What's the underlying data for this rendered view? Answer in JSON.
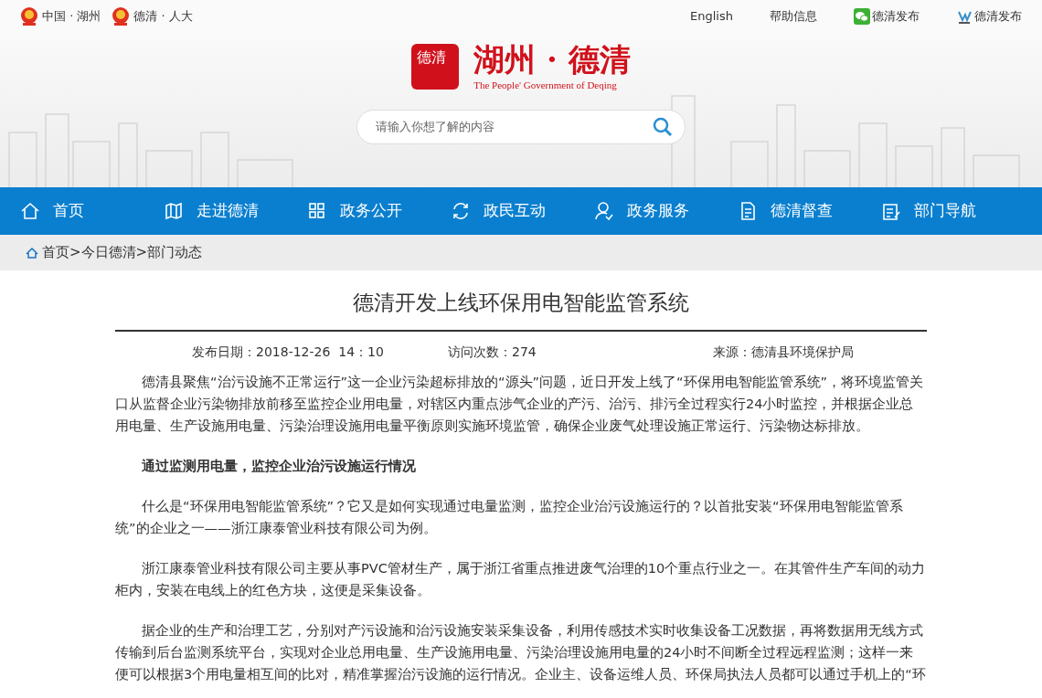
{
  "top_links_left": [
    {
      "label": "中国 · 湖州"
    },
    {
      "label": "德清 · 人大"
    }
  ],
  "top_links_right": [
    {
      "kind": "text",
      "label": "English"
    },
    {
      "kind": "text",
      "label": "帮助信息"
    },
    {
      "kind": "wechat",
      "label": "德清发布"
    },
    {
      "kind": "weibo",
      "label": "德清发布"
    }
  ],
  "logo": {
    "seal": "德清",
    "title": "湖州 · 德清",
    "subtitle": "The People' Government of Deqing"
  },
  "search": {
    "placeholder": "请输入你想了解的内容"
  },
  "nav": [
    {
      "label": "首页"
    },
    {
      "label": "走进德清"
    },
    {
      "label": "政务公开"
    },
    {
      "label": "政民互动"
    },
    {
      "label": "政务服务"
    },
    {
      "label": "德清督查"
    },
    {
      "label": "部门导航"
    }
  ],
  "breadcrumb": [
    "首页",
    ">",
    "今日德清",
    ">",
    "部门动态"
  ],
  "article": {
    "title": "德清开发上线环保用电智能监管系统",
    "meta": [
      "发布日期：2018-12-26  14：10",
      "访问次数：274",
      "来源：德清县环境保护局"
    ],
    "paragraphs": [
      {
        "kind": "text",
        "text": "德清县聚焦“治污设施不正常运行”这一企业污染超标排放的“源头”问题，近日开发上线了“环保用电智能监管系统”，将环境监管关口从监督企业污染物排放前移至监控企业用电量，对辖区内重点涉气企业的产污、治污、排污全过程实行24小时监控，并根据企业总用电量、生产设施用电量、污染治理设施用电量平衡原则实施环境监管，确保企业废气处理设施正常运行、污染物达标排放。"
      },
      {
        "kind": "heading",
        "text": "通过监测用电量，监控企业治污设施运行情况"
      },
      {
        "kind": "text",
        "text": "什么是“环保用电智能监管系统”？它又是如何实现通过电量监测，监控企业治污设施运行的？以首批安装“环保用电智能监管系统”的企业之一——浙江康泰管业科技有限公司为例。"
      },
      {
        "kind": "text",
        "text": "浙江康泰管业科技有限公司主要从事PVC管材生产，属于浙江省重点推进废气治理的10个重点行业之一。在其管件生产车间的动力柜内，安装在电线上的红色方块，这便是采集设备。"
      },
      {
        "kind": "text",
        "text": "据企业的生产和治理工艺，分别对产污设施和治污设施安装采集设备，利用传感技术实时收集设备工况数据，再将数据用无线方式传输到后台监测系统平台，实现对企业总用电量、生产设施用电量、污染治理设施用电量的24小时不间断全过程远程监测；这样一来便可以根据3个用电量相互间的比对，精准掌握治污设施的运行情况。企业主、设备运维人员、环保局执法人员都可以通过手机上的“环"
      }
    ]
  }
}
